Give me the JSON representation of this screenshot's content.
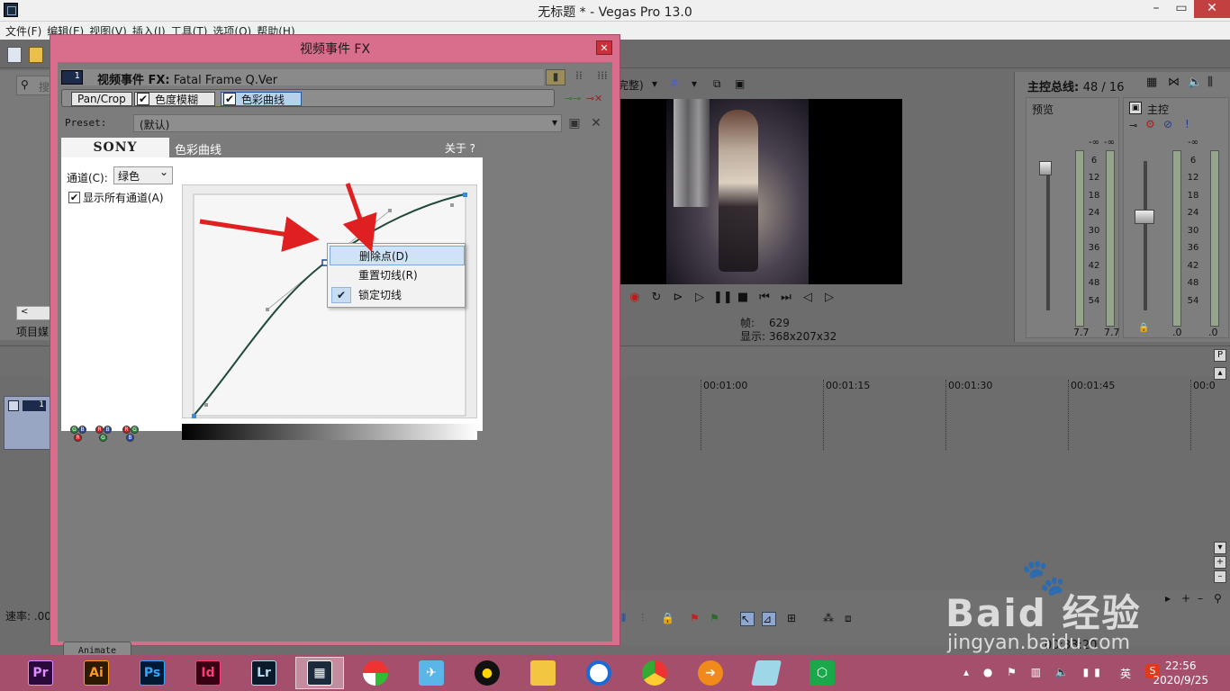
{
  "window": {
    "title": "无标题 * - Vegas Pro 13.0"
  },
  "menu": [
    "文件(F)",
    "编辑(E)",
    "视图(V)",
    "插入(I)",
    "工具(T)",
    "选项(O)",
    "帮助(H)"
  ],
  "explorer": {
    "search_placeholder": "搜",
    "tab_label": "项目媒",
    "scroll_left": "<"
  },
  "preview": {
    "quality_label": "完整)",
    "frame_label": "帧:",
    "frame_value": "629",
    "display_label": "显示:",
    "display_value": "368x207x32"
  },
  "master_bus": {
    "title": "主控总线:",
    "count": "48 / 16",
    "preview_label": "预览",
    "master_label": "主控",
    "scale": [
      "-∞",
      "6",
      "12",
      "18",
      "24",
      "30",
      "36",
      "42",
      "48",
      "54"
    ],
    "left_values": [
      "7.7",
      "7.7"
    ],
    "right_values": [
      ".0",
      ".0"
    ]
  },
  "timeline": {
    "marks": [
      "00:01:00",
      "00:01:15",
      "00:01:30",
      "00:01:45",
      "00:0"
    ],
    "rate_label": "速率: .00",
    "timecode": "00:33:20"
  },
  "fx_dialog": {
    "title": "视频事件 FX",
    "header_prefix": "视频事件 FX:",
    "header_name": "Fatal Frame Q.Ver",
    "chain_badge": "1",
    "plugins": [
      "Pan/Crop",
      "色度模糊",
      "色彩曲线"
    ],
    "preset_label": "Preset:",
    "preset_value": "(默认)",
    "animate_label": "Animate"
  },
  "plugin": {
    "brand": "SONY",
    "name": "色彩曲线",
    "about": "关于  ?",
    "channel_label": "通道(C):",
    "channel_value": "绿色",
    "show_all_label": "显示所有通道(A)"
  },
  "context_menu": {
    "items": [
      "删除点(D)",
      "重置切线(R)",
      "锁定切线"
    ]
  },
  "watermark": {
    "main": "Baid 经验",
    "sub": "jingyan.baidu.com"
  },
  "taskbar": {
    "apps": [
      "Pr",
      "Ai",
      "Ps",
      "Id",
      "Lr"
    ],
    "time": "22:56",
    "date": "2020/9/25",
    "ime": "英"
  },
  "colors": {
    "dialog_frame": "#d86e8c",
    "taskbar": "#a4506c",
    "curve": "#1f4a36",
    "arrow": "#e02020"
  }
}
